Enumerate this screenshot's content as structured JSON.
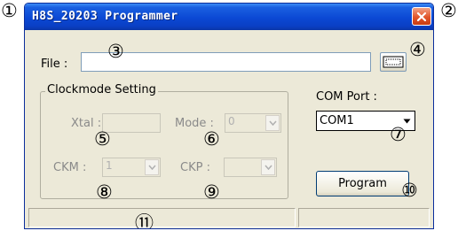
{
  "window": {
    "title": "H8S_20203 Programmer"
  },
  "file": {
    "label": "File :",
    "value": ""
  },
  "clockmode": {
    "legend": "Clockmode Setting",
    "xtal_label": "Xtal :",
    "xtal_value": "",
    "mode_label": "Mode :",
    "mode_value": "0",
    "ckm_label": "CKM :",
    "ckm_value": "1",
    "ckp_label": "CKP :",
    "ckp_value": ""
  },
  "com": {
    "label": "COM Port :",
    "value": "COM1"
  },
  "program_button": "Program",
  "markers": [
    "①",
    "②",
    "③",
    "④",
    "⑤",
    "⑥",
    "⑦",
    "⑧",
    "⑨",
    "⑩",
    "⑪"
  ],
  "icons": {
    "close": "close-icon",
    "browse": "browse-icon",
    "dropdown": "chevron-down-icon"
  }
}
